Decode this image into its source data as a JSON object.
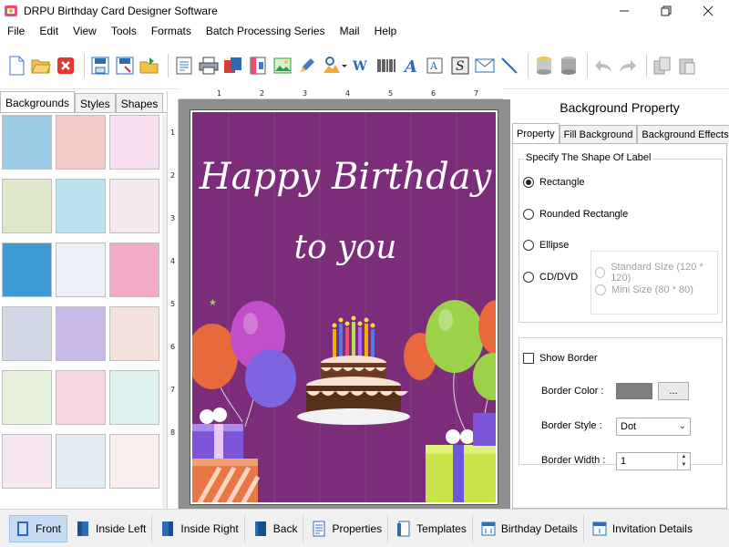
{
  "window": {
    "title": "DRPU Birthday Card Designer Software",
    "controls": [
      "minimize",
      "restore",
      "close"
    ]
  },
  "menu": [
    "File",
    "Edit",
    "View",
    "Tools",
    "Formats",
    "Batch Processing Series",
    "Mail",
    "Help"
  ],
  "toolbar": {
    "groups": [
      [
        "new-file-icon",
        "open-folder-icon",
        "close-file-icon"
      ],
      [
        "save-icon",
        "save-as-icon",
        "export-icon"
      ],
      [
        "document-icon",
        "print-icon",
        "copy-pages-icon",
        "pdf-icon",
        "image-icon",
        "pen-icon",
        "picture-icon",
        "barcode-icon",
        "wordart-icon",
        "text-icon",
        "text-box-icon",
        "signature-icon",
        "mail-icon",
        "line-icon"
      ],
      [
        "database-icon",
        "database-settings-icon"
      ],
      [
        "undo-icon",
        "redo-icon"
      ],
      [
        "copy-icon",
        "paste-icon"
      ]
    ]
  },
  "left_panel": {
    "tabs": [
      "Backgrounds",
      "Styles",
      "Shapes"
    ],
    "active_tab": "Backgrounds",
    "thumbnails": [
      {
        "name": "clouds-bg",
        "color": "#9ccbe8"
      },
      {
        "name": "pink-swirl-bg",
        "color": "#f4cbc6"
      },
      {
        "name": "butterfly-bg",
        "color": "#f7dff0"
      },
      {
        "name": "daisy-bg",
        "color": "#dfe9c9"
      },
      {
        "name": "kids-bg",
        "color": "#b9e4ee"
      },
      {
        "name": "bunny-balloon-bg",
        "color": "#f5e9ef"
      },
      {
        "name": "stars-bg",
        "color": "#3d9bd6"
      },
      {
        "name": "balloons-bg",
        "color": "#eef0f8"
      },
      {
        "name": "birthday-pink-bg",
        "color": "#f3a9c8"
      },
      {
        "name": "bubbles-bg",
        "color": "#d2d8e6"
      },
      {
        "name": "rainbow-bg",
        "color": "#c9b9e6"
      },
      {
        "name": "floral-bg",
        "color": "#f3e3dc"
      },
      {
        "name": "happy-birthday-bg",
        "color": "#e9f2dc"
      },
      {
        "name": "pink-hearts-bg",
        "color": "#f8d5e0"
      },
      {
        "name": "confetti-bg",
        "color": "#dff2f0"
      },
      {
        "name": "colorful-hearts-bg",
        "color": "#f6e7f0"
      },
      {
        "name": "balloon-bunch-bg",
        "color": "#e6ecf6"
      },
      {
        "name": "red-hearts-bg",
        "color": "#fbeeee"
      }
    ]
  },
  "ruler": {
    "top": [
      "1",
      "2",
      "3",
      "4",
      "5",
      "6",
      "7"
    ],
    "left": [
      "1",
      "2",
      "3",
      "4",
      "5",
      "6",
      "7",
      "8"
    ]
  },
  "card": {
    "line1": "Happy Birthday",
    "line2": "to you",
    "background": "#7b2d7a"
  },
  "right_panel": {
    "title": "Background Property",
    "tabs": [
      "Property",
      "Fill Background",
      "Background Effects"
    ],
    "active_tab": "Property",
    "shape_group": {
      "legend": "Specify The Shape Of Label",
      "options": [
        "Rectangle",
        "Rounded Rectangle",
        "Ellipse",
        "CD/DVD"
      ],
      "selected": "Rectangle",
      "cd_sizes": [
        "Standard Size (120 * 120)",
        "Mini Size (80 * 80)"
      ]
    },
    "border": {
      "show_label": "Show Border",
      "show_checked": false,
      "color_label": "Border Color :",
      "color_value": "#808080",
      "color_button": "...",
      "style_label": "Border Style :",
      "style_value": "Dot",
      "width_label": "Border Width :",
      "width_value": "1"
    }
  },
  "bottom_bar": {
    "buttons": [
      "Front",
      "Inside Left",
      "Inside Right",
      "Back",
      "Properties",
      "Templates",
      "Birthday Details",
      "Invitation Details"
    ],
    "active": "Front"
  }
}
